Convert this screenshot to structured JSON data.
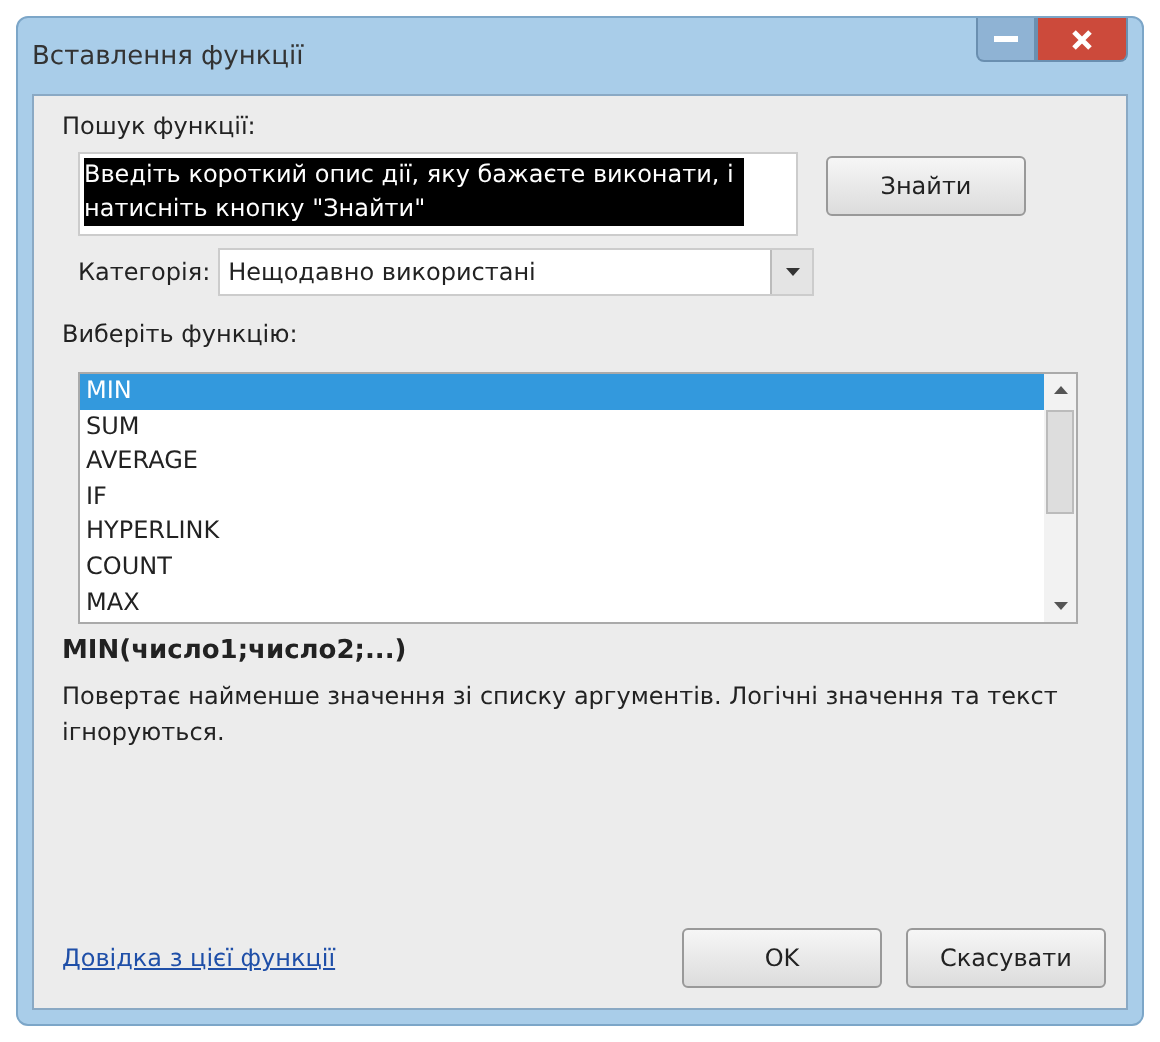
{
  "window": {
    "title": "Вставлення функції"
  },
  "search": {
    "label": "Пошук функції:",
    "value": "Введіть короткий опис дії, яку бажаєте виконати, і натисніть кнопку \"Знайти\"",
    "button": "Знайти"
  },
  "category": {
    "label": "Категорія:",
    "value": "Нещодавно використані"
  },
  "function_list": {
    "label": "Виберіть функцію:",
    "items": [
      {
        "name": "MIN",
        "selected": true
      },
      {
        "name": "SUM",
        "selected": false
      },
      {
        "name": "AVERAGE",
        "selected": false
      },
      {
        "name": "IF",
        "selected": false
      },
      {
        "name": "HYPERLINK",
        "selected": false
      },
      {
        "name": "COUNT",
        "selected": false
      },
      {
        "name": "MAX",
        "selected": false
      }
    ]
  },
  "signature": "MIN(число1;число2;...)",
  "description": "Повертає найменше значення зі списку аргументів. Логічні значення та текст ігноруються.",
  "help_link": "Довідка з цієї функції",
  "buttons": [
    "OK",
    "Скасувати"
  ]
}
